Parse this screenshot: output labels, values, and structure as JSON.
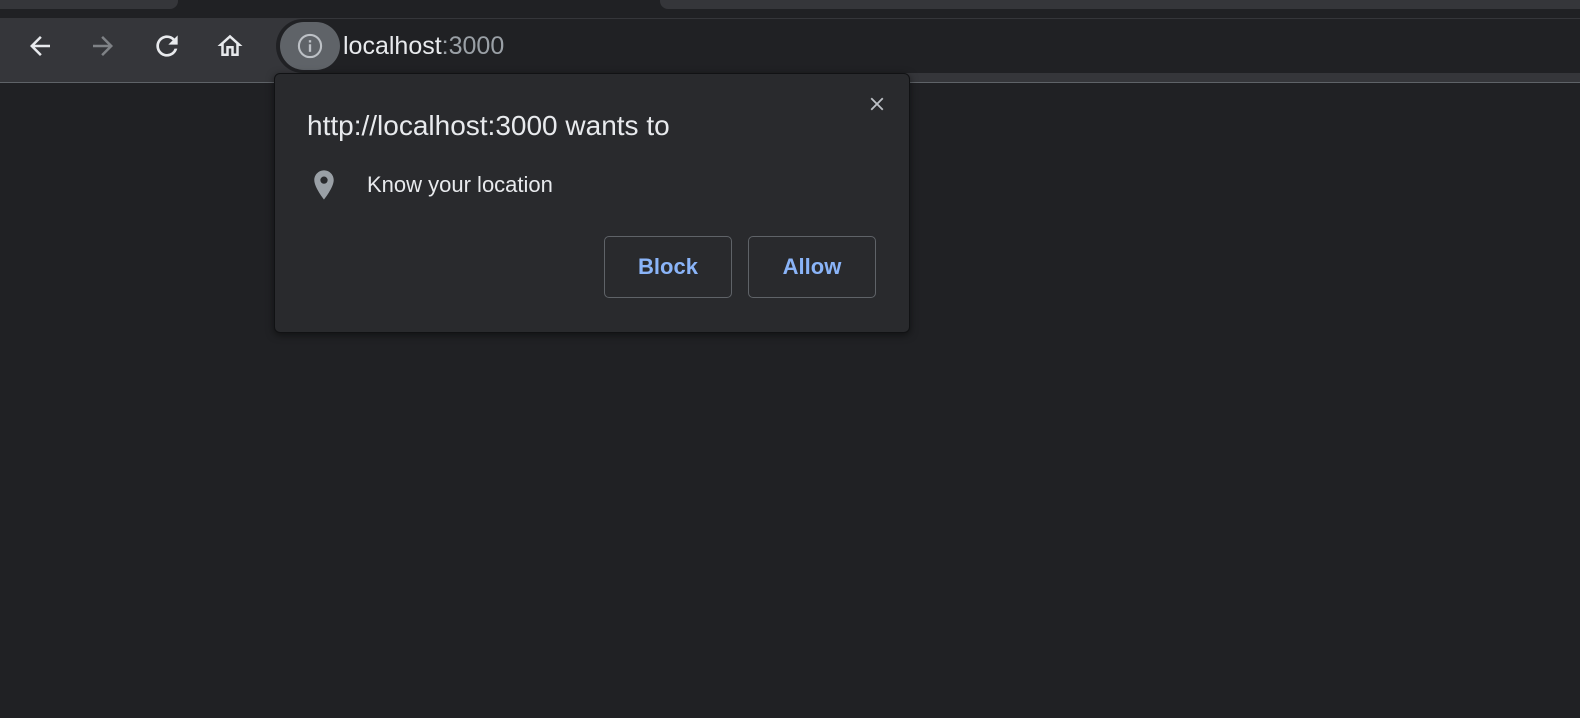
{
  "toolbar": {
    "back_icon": "back-arrow-icon",
    "forward_icon": "forward-arrow-icon",
    "reload_icon": "reload-icon",
    "home_icon": "home-icon"
  },
  "omnibox": {
    "site_info_icon": "info-icon",
    "host": "localhost",
    "port": ":3000"
  },
  "permission_dialog": {
    "title": "http://localhost:3000 wants to",
    "permission_icon": "location-pin-icon",
    "permission_label": "Know your location",
    "block_label": "Block",
    "allow_label": "Allow",
    "close_icon": "close-icon"
  },
  "colors": {
    "background": "#202124",
    "toolbar": "#35363a",
    "dialog": "#292a2d",
    "text": "#e8eaed",
    "muted_text": "#9aa0a6",
    "accent": "#8ab4f8"
  }
}
